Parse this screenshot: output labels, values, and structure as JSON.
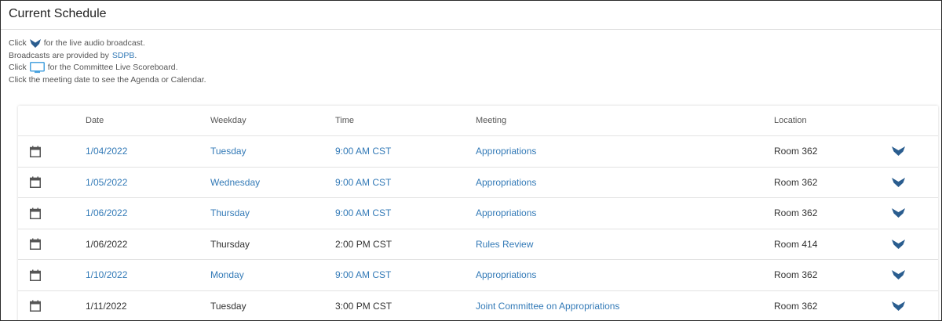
{
  "page": {
    "title": "Current Schedule"
  },
  "instructions": {
    "line1_before": "Click",
    "line1_after": "for the live audio broadcast.",
    "line2_before": "Broadcasts are provided by",
    "line2_link": "SDPB",
    "line2_after": ".",
    "line3_before": "Click",
    "line3_after": "for the Committee Live Scoreboard.",
    "line4": "Click the meeting date to see the Agenda or Calendar."
  },
  "table": {
    "headers": {
      "date": "Date",
      "weekday": "Weekday",
      "time": "Time",
      "meeting": "Meeting",
      "location": "Location"
    },
    "rows": [
      {
        "date": "1/04/2022",
        "weekday": "Tuesday",
        "time": "9:00 AM CST",
        "meeting": "Appropriations",
        "location": "Room 362",
        "date_linked": true
      },
      {
        "date": "1/05/2022",
        "weekday": "Wednesday",
        "time": "9:00 AM CST",
        "meeting": "Appropriations",
        "location": "Room 362",
        "date_linked": true
      },
      {
        "date": "1/06/2022",
        "weekday": "Thursday",
        "time": "9:00 AM CST",
        "meeting": "Appropriations",
        "location": "Room 362",
        "date_linked": true
      },
      {
        "date": "1/06/2022",
        "weekday": "Thursday",
        "time": "2:00 PM CST",
        "meeting": "Rules Review",
        "location": "Room 414",
        "date_linked": false
      },
      {
        "date": "1/10/2022",
        "weekday": "Monday",
        "time": "9:00 AM CST",
        "meeting": "Appropriations",
        "location": "Room 362",
        "date_linked": true
      },
      {
        "date": "1/11/2022",
        "weekday": "Tuesday",
        "time": "3:00 PM CST",
        "meeting": "Joint Committee on Appropriations",
        "location": "Room 362",
        "date_linked": false
      }
    ]
  },
  "icons": {
    "calendar": "calendar-icon",
    "audio": "audio-broadcast-icon",
    "scoreboard": "monitor-icon"
  },
  "colors": {
    "link": "#337ab7",
    "audio_icon": "#2a5d8f",
    "monitor_icon": "#4aa3df",
    "calendar_icon": "#555555"
  }
}
